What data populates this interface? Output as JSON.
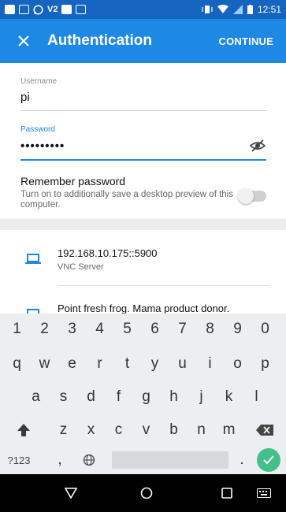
{
  "statusbar": {
    "notification_icons": [
      "image-icon",
      "message-icon",
      "whatsapp-icon",
      "voicemail-icon",
      "gallery-icon",
      "calendar-icon"
    ],
    "voicemail_text": "V2",
    "time": "12:51"
  },
  "appbar": {
    "title": "Authentication",
    "continue_label": "CONTINUE",
    "color": "#1e88e5"
  },
  "username": {
    "label": "Username",
    "value": "pi"
  },
  "password": {
    "label": "Password",
    "value": "•••••••••"
  },
  "remember": {
    "title": "Remember password",
    "description": "Turn on to additionally save a desktop preview of this computer.",
    "enabled": false
  },
  "servers": [
    {
      "title": "192.168.10.175::5900",
      "subtitle": "VNC Server"
    },
    {
      "title": "Point fresh frog. Mama product donor.",
      "subtitle": ""
    }
  ],
  "keyboard": {
    "row1": [
      "1",
      "2",
      "3",
      "4",
      "5",
      "6",
      "7",
      "8",
      "9",
      "0"
    ],
    "row2": [
      "q",
      "w",
      "e",
      "r",
      "t",
      "y",
      "u",
      "i",
      "o",
      "p"
    ],
    "row3": [
      "a",
      "s",
      "d",
      "f",
      "g",
      "h",
      "j",
      "k",
      "l"
    ],
    "row4": [
      "z",
      "x",
      "c",
      "v",
      "b",
      "n",
      "m"
    ],
    "symbols_label": "?123",
    "comma": ",",
    "period": ".",
    "enter_color": "#43c08a"
  }
}
